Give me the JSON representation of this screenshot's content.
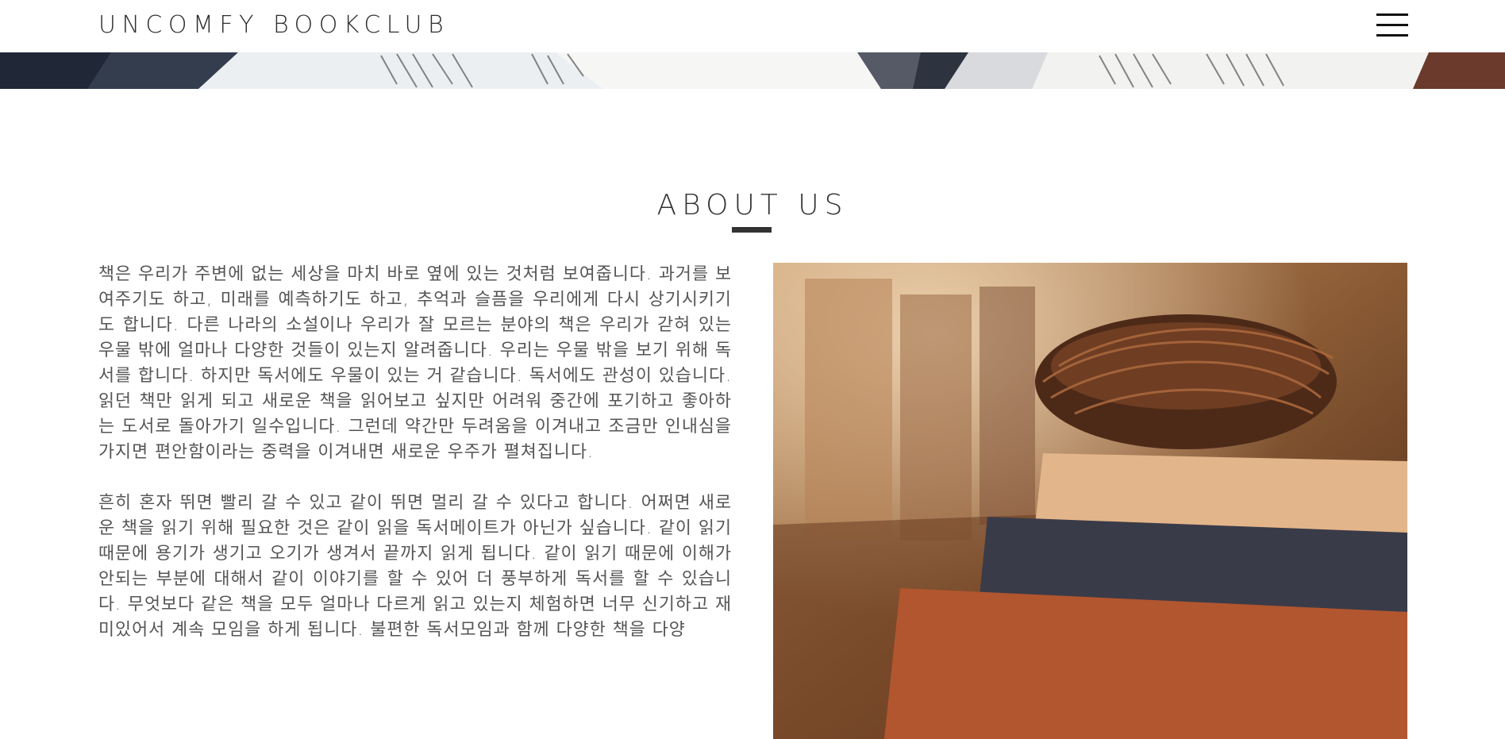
{
  "header": {
    "logo": "UNCOMFY BOOKCLUB",
    "menu_icon": "hamburger-menu-icon"
  },
  "banner": {
    "image": "open-books-photo"
  },
  "about": {
    "title": "ABOUT US",
    "paragraphs": [
      "책은 우리가 주변에 없는 세상을 마치 바로 옆에 있는 것처럼 보여줍니다. 과거를 보여주기도 하고, 미래를 예측하기도 하고, 추억과 슬픔을 우리에게 다시 상기시키기도 합니다. 다른 나라의 소설이나 우리가 잘 모르는 분야의 책은 우리가 갇혀 있는 우물 밖에 얼마나 다양한 것들이 있는지 알려줍니다. 우리는 우물 밖을 보기 위해 독서를 합니다. 하지만 독서에도 우물이 있는 거 같습니다. 독서에도 관성이 있습니다. 읽던 책만 읽게 되고 새로운 책을 읽어보고 싶지만 어려워 중간에 포기하고 좋아하는 도서로 돌아가기 일수입니다. 그런데 약간만 두려움을 이겨내고 조금만 인내심을 가지면 편안함이라는 중력을 이겨내면 새로운 우주가 펼쳐집니다.",
      "흔히 혼자 뛰면 빨리 갈 수 있고 같이 뛰면 멀리 갈 수 있다고 합니다. 어쩌면 새로운 책을 읽기 위해 필요한 것은 같이 읽을 독서메이트가 아닌가 싶습니다. 같이 읽기 때문에 용기가 생기고 오기가 생겨서 끝까지 읽게 됩니다. 같이 읽기 때문에 이해가 안되는 부분에 대해서 같이 이야기를 할 수 있어 더 풍부하게 독서를 할 수 있습니다. 무엇보다 같은 책을 모두 얼마나 다르게 읽고 있는지 체험하면 너무 신기하고 재미있어서 계속 모임을 하게 됩니다. 불편한 독서모임과 함께 다양한 책을 다양"
    ],
    "photo": "bird-nest-on-books-photo"
  },
  "colors": {
    "text": "#555555",
    "heading": "#333333",
    "accent_bar": "#333333",
    "background": "#ffffff"
  }
}
